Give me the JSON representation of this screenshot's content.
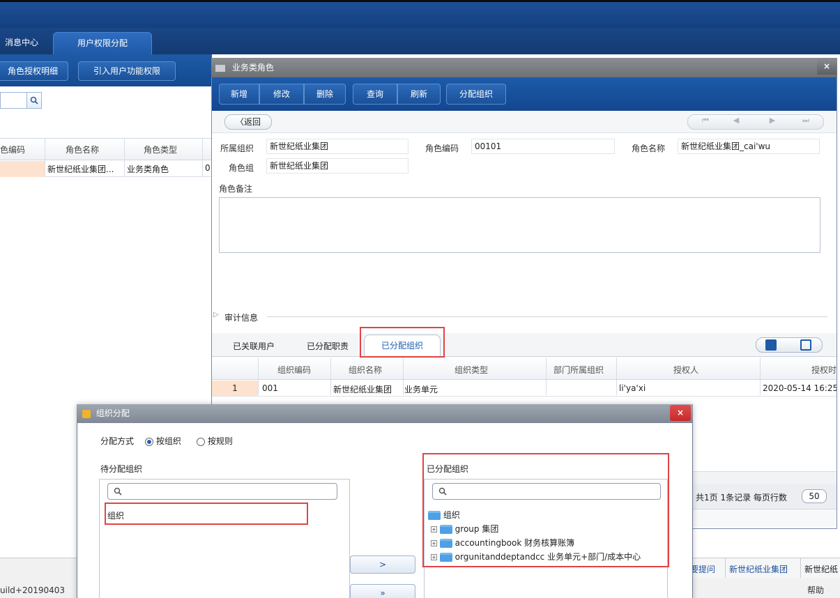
{
  "header": {
    "tabs": [
      {
        "label": "消息中心"
      },
      {
        "label": "用户权限分配"
      }
    ]
  },
  "left": {
    "buttons": [
      "角色授权明细",
      "引入用户功能权限"
    ],
    "columns": [
      "色编码",
      "角色名称",
      "角色类型"
    ],
    "row": {
      "name": "新世纪纸业集团...",
      "type": "业务类角色",
      "extra": "0"
    },
    "build": "uild+20190403"
  },
  "role_window": {
    "title": "业务类角色",
    "close": "×",
    "toolbar": [
      "新增",
      "修改",
      "删除",
      "查询",
      "刷新",
      "分配组织"
    ],
    "back": "〈返回",
    "fields": {
      "org_label": "所属组织",
      "org_value": "新世纪纸业集团",
      "code_label": "角色编码",
      "code_value": "00101",
      "name_label": "角色名称",
      "name_value": "新世纪纸业集团_cai'wu",
      "group_label": "角色组",
      "group_value": "新世纪纸业集团",
      "note_label": "角色备注"
    },
    "audit_label": "审计信息",
    "subtabs": [
      "已关联用户",
      "已分配职责",
      "已分配组织"
    ],
    "grid": {
      "columns": [
        "组织编码",
        "组织名称",
        "组织类型",
        "部门所属组织",
        "授权人",
        "授权时"
      ],
      "rows": [
        {
          "num": "1",
          "code": "001",
          "name": "新世纪纸业集团",
          "type": "业务单元",
          "dept": "",
          "grantor": "li'ya'xi",
          "time": "2020-05-14 16:25"
        }
      ]
    },
    "footer": {
      "summary": "共1页 1条记录 每页行数",
      "page_size": "50"
    }
  },
  "taskbar": {
    "items": [
      "要提问",
      "新世纪纸业集团",
      "新世纪纸"
    ],
    "help": "帮助"
  },
  "org_dialog": {
    "title": "组织分配",
    "close": "×",
    "mode_label": "分配方式",
    "mode_options": [
      {
        "label": "按组织",
        "selected": true
      },
      {
        "label": "按规则",
        "selected": false
      }
    ],
    "pending_title": "待分配组织",
    "pending_tree": [
      "组织"
    ],
    "assigned_title": "已分配组织",
    "assigned_root": "组织",
    "assigned_tree": [
      "group 集团",
      "accountingbook 财务核算账簿",
      "orgunitanddeptandcc 业务单元+部门/成本中心"
    ],
    "move_buttons": [
      ">",
      "»"
    ]
  }
}
